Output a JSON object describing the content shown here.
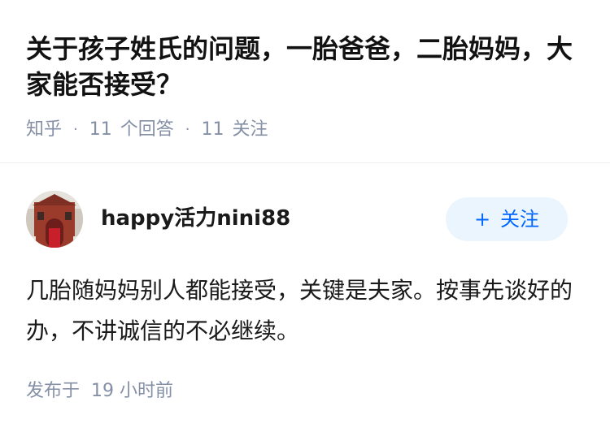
{
  "question": {
    "title": "关于孩子姓氏的问题，一胎爸爸，二胎妈妈，大家能否接受？",
    "source": "知乎",
    "answer_count": "11",
    "answer_label": "个回答",
    "follower_count": "11",
    "follower_label": "关注"
  },
  "answer": {
    "author_name": "happy活力nini88",
    "avatar_icon": "avatar-church-photo",
    "follow_label": "关注",
    "follow_plus": "+",
    "text": "几胎随妈妈别人都能接受，关键是夫家。按事先谈好的办，不讲诚信的不必继续。",
    "time_prefix": "发布于",
    "time_value": "19",
    "time_suffix": "小时前"
  },
  "colors": {
    "accent": "#0066ff",
    "follow_bg": "#ebf5fd",
    "meta": "#8590a6"
  }
}
